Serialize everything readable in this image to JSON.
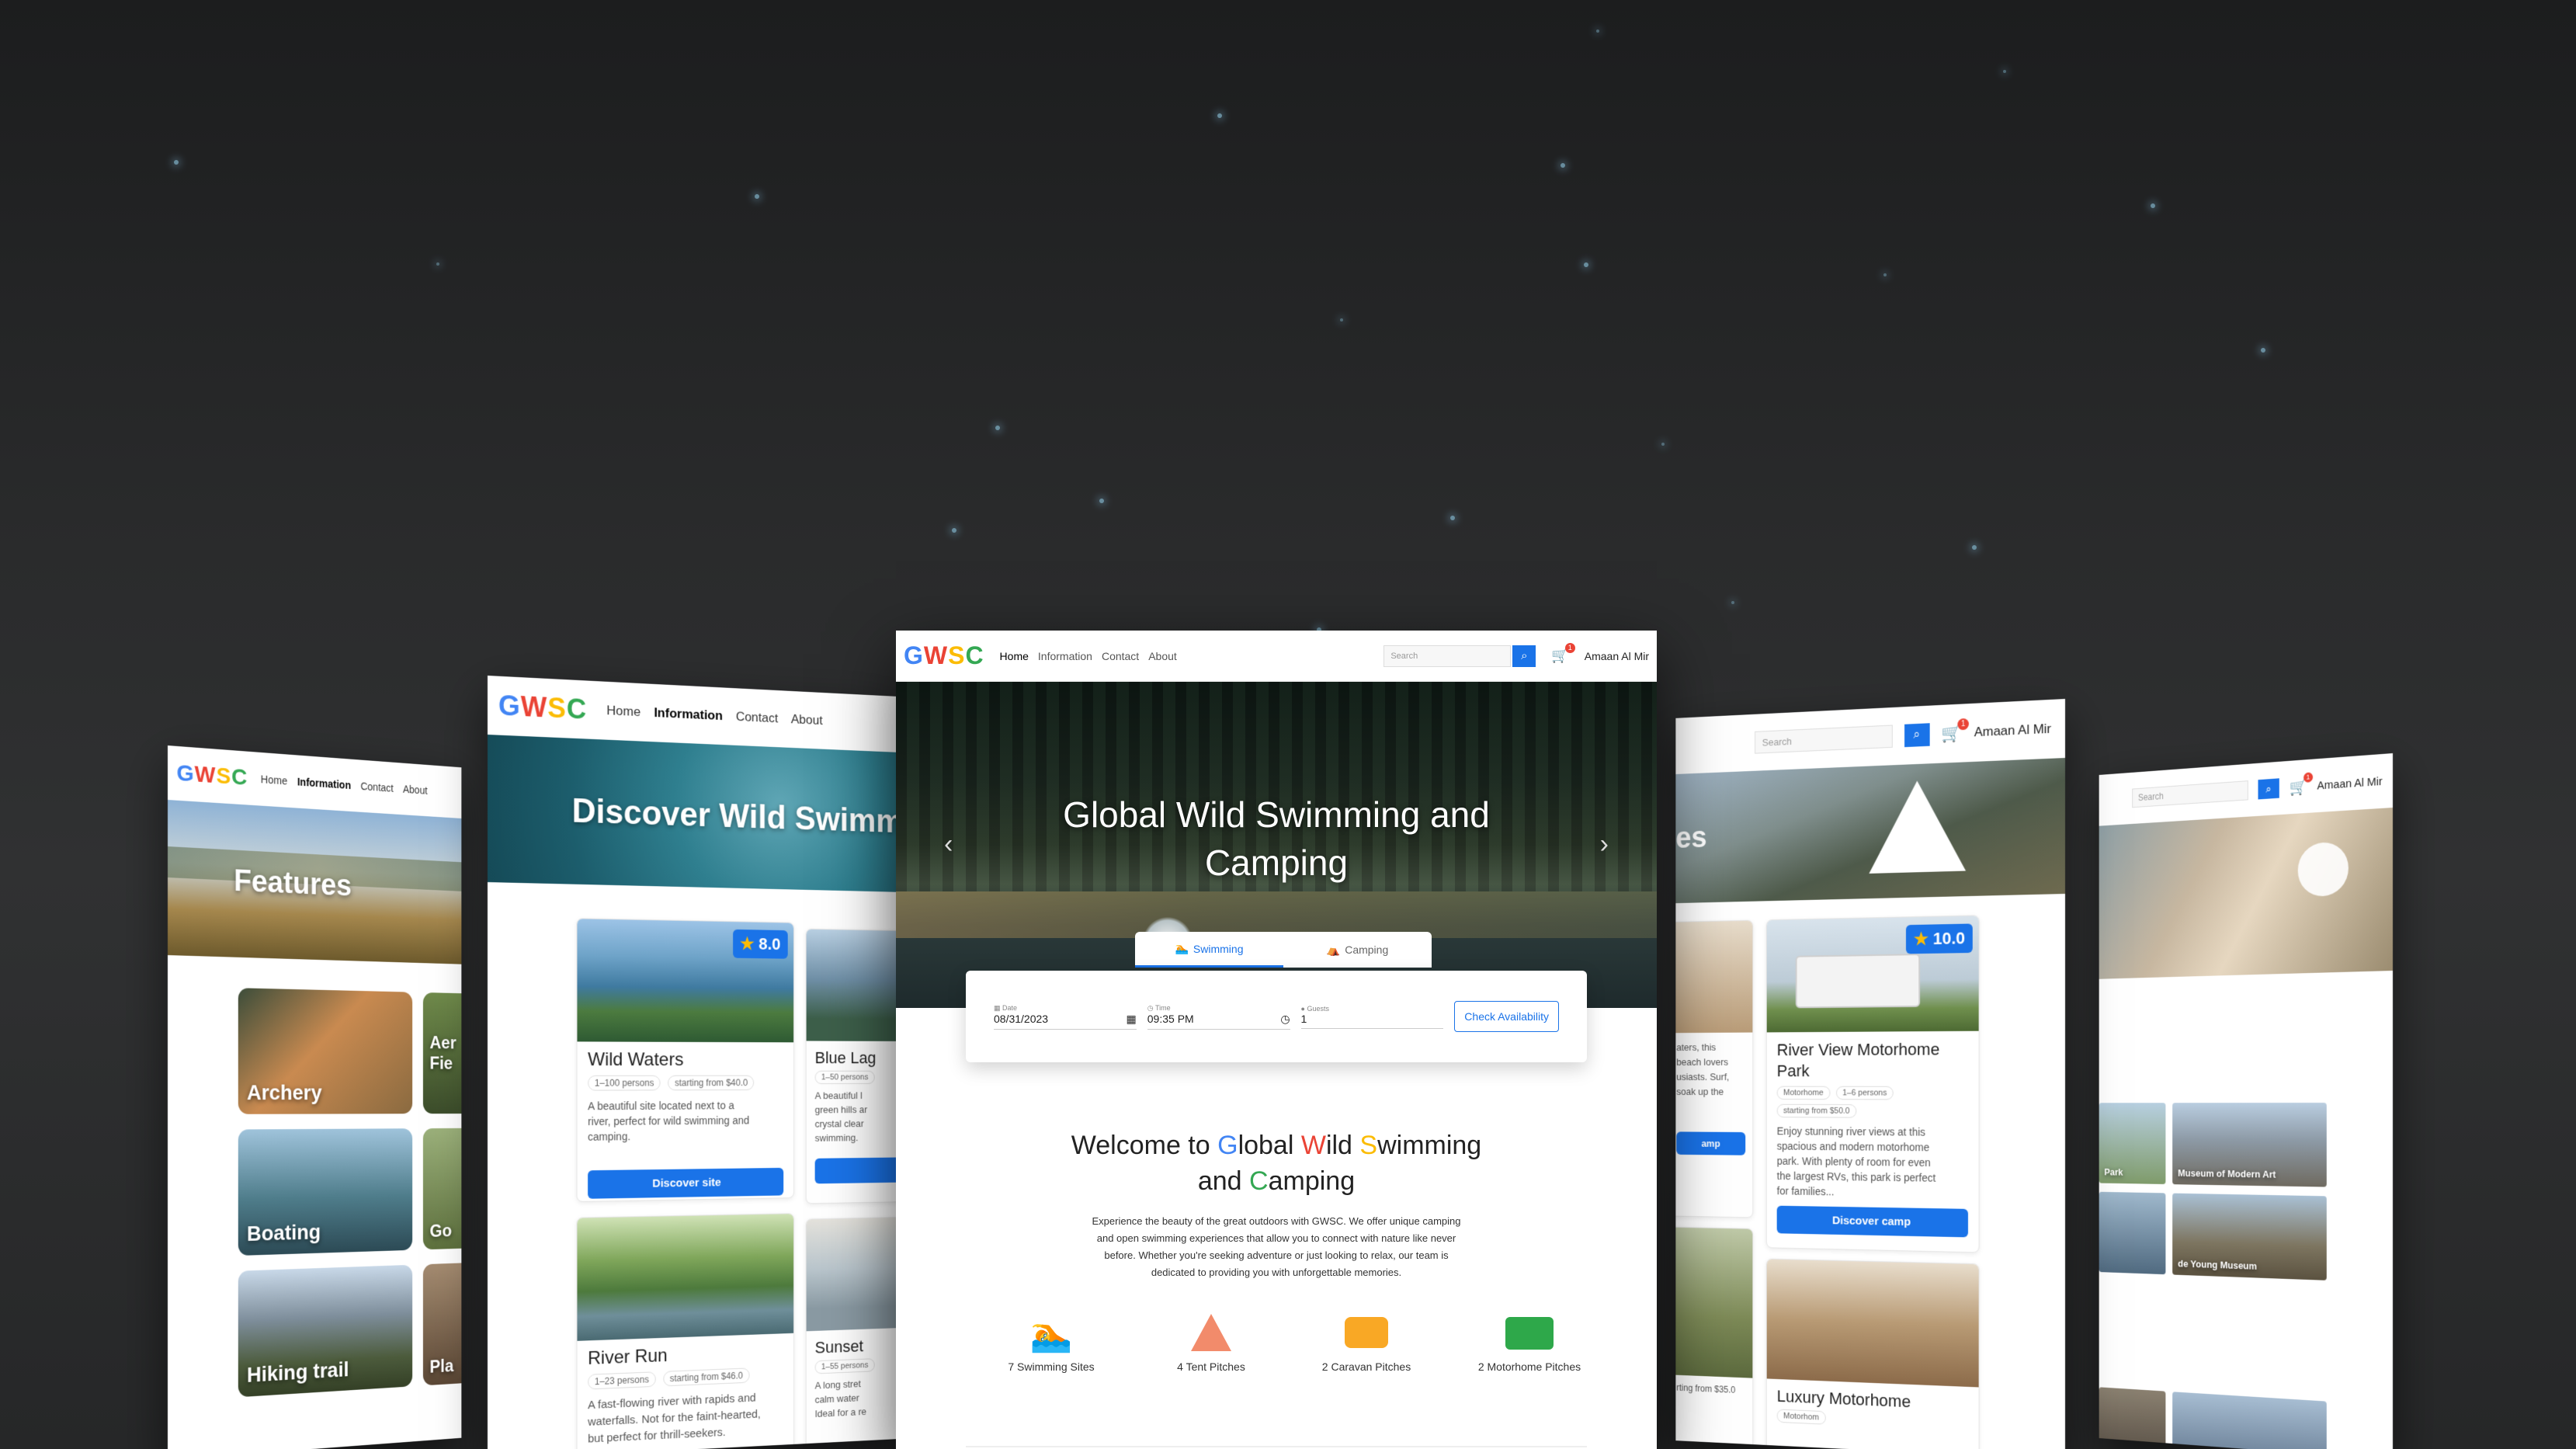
{
  "brand": {
    "letters": [
      "G",
      "W",
      "S",
      "C"
    ]
  },
  "nav": {
    "home": "Home",
    "information": "Information",
    "contact": "Contact",
    "about": "About"
  },
  "header": {
    "search_placeholder": "Search",
    "user_name": "Amaan Al Mir",
    "cart_count": "1"
  },
  "hero": {
    "title_line1": "Global Wild Swimming and",
    "title_line2": "Camping",
    "prev": "‹",
    "next": "›"
  },
  "tabs": {
    "swimming": "Swimming",
    "camping": "Camping"
  },
  "booking": {
    "date_label": "Date",
    "date_value": "08/31/2023",
    "time_label": "Time",
    "time_value": "09:35 PM",
    "guests_label": "Guests",
    "guests_value": "1",
    "check_button": "Check Availability"
  },
  "welcome": {
    "parts": [
      "Welcome to ",
      "G",
      "lobal ",
      "W",
      "ild ",
      "S",
      "wimming"
    ],
    "line2_parts": [
      "and ",
      "C",
      "amping"
    ],
    "paragraph_lines": [
      "Experience the beauty of the great outdoors with GWSC. We offer unique camping",
      "and open swimming experiences that allow you to connect with nature like never",
      "before. Whether you're seeking adventure or just looking to relax, our team is",
      "dedicated to providing you with unforgettable memories."
    ]
  },
  "stats": [
    {
      "label": "7 Swimming Sites",
      "icon": "swimmer-icon",
      "color": "#1e88e5"
    },
    {
      "label": "4 Tent Pitches",
      "icon": "tent-icon",
      "color": "#f28b6b"
    },
    {
      "label": "2 Caravan Pitches",
      "icon": "caravan-icon",
      "color": "#f9a825"
    },
    {
      "label": "2 Motorhome Pitches",
      "icon": "motorhome-icon",
      "color": "#2ea84a"
    }
  ],
  "features_page": {
    "title": "Features",
    "tiles": [
      "Archery",
      "Boating",
      "Hiking trail",
      "Aer",
      "Fie",
      "Go",
      "Pla"
    ]
  },
  "discover_page": {
    "title": "Discover Wild Swimm",
    "cards": [
      {
        "name": "Wild Waters",
        "persons": "1–100 persons",
        "price": "starting from $40.0",
        "rating": "8.0",
        "desc": [
          "A beautiful site located next to a",
          "river, perfect for wild swimming and",
          "camping."
        ],
        "button": "Discover site"
      },
      {
        "name": "Blue Lag",
        "persons": "1–50 persons",
        "desc": [
          "A beautiful l",
          "green hills ar",
          "crystal clear",
          "swimming."
        ]
      },
      {
        "name": "River Run",
        "persons": "1–23 persons",
        "price": "starting from $46.0",
        "desc": [
          "A fast-flowing river with rapids and",
          "waterfalls. Not for the faint-hearted,",
          "but perfect for thrill-seekers."
        ]
      },
      {
        "name": "Sunset",
        "persons": "1–55 persons",
        "desc": [
          "A long stret",
          "calm water",
          "Ideal for a re"
        ]
      }
    ]
  },
  "camps_page": {
    "title_frag": "es",
    "left_desc": [
      "aters, this",
      "beach lovers",
      "usiasts. Surf,",
      "soak up the"
    ],
    "left_button": "amp",
    "left_price": "rting from $35.0",
    "cards": [
      {
        "name_line1": "River View Motorhome",
        "name_line2": "Park",
        "rating": "10.0",
        "chips": [
          "Motorhome",
          "1–6 persons"
        ],
        "price": "starting from $50.0",
        "desc": [
          "Enjoy stunning river views at this",
          "spacious and modern motorhome",
          "park. With plenty of room for even",
          "the largest RVs, this park is perfect",
          "for families..."
        ],
        "button": "Discover camp"
      },
      {
        "name_line1": "Luxury Motorhome",
        "chips": [
          "Motorhom"
        ]
      }
    ]
  },
  "attractions_page": {
    "tiles": [
      "Park",
      "Museum of Modern Art",
      "de Young Museum"
    ]
  },
  "colors": {
    "accent": "#1a73e8",
    "background": "#2a2b2c"
  }
}
